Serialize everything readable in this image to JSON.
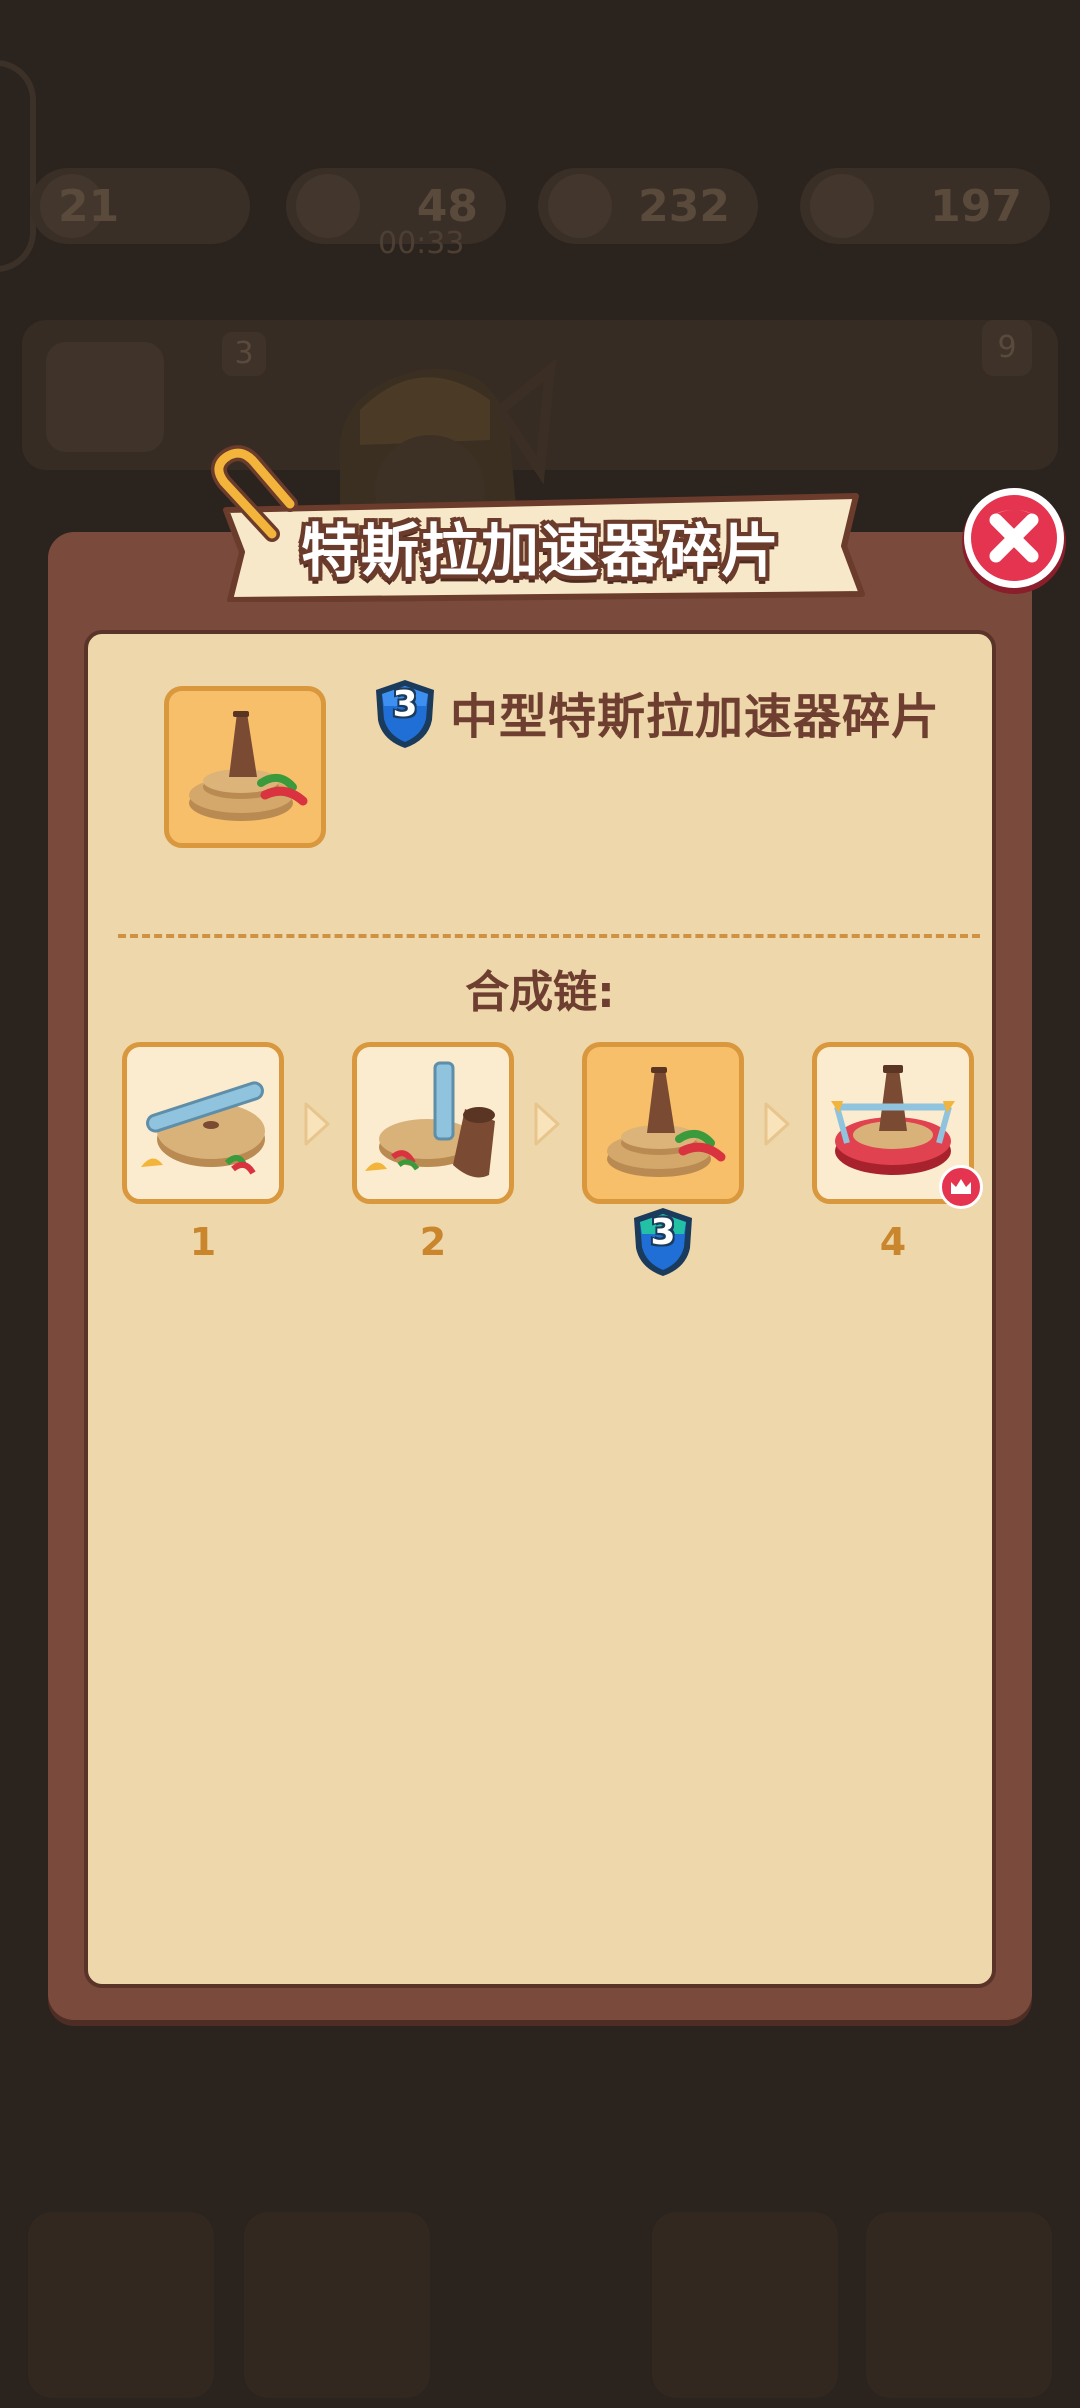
{
  "background": {
    "stats": [
      "21",
      "48",
      "00:33",
      "232",
      "197"
    ],
    "card_badge_left": "3",
    "card_badge_right": "9"
  },
  "modal": {
    "title": "特斯拉加速器碎片",
    "item": {
      "tier": "3",
      "name": "中型特斯拉加速器碎片"
    },
    "chain_label": "合成链:",
    "chain": [
      {
        "level": "1",
        "current": false
      },
      {
        "level": "2",
        "current": false
      },
      {
        "level": "3",
        "current": true
      },
      {
        "level": "4",
        "current": false,
        "max": true
      }
    ]
  },
  "colors": {
    "frame": "#7a4a3d",
    "panel": "#eed7ab",
    "slot_highlight": "#f7bf6a",
    "close_red": "#e4344f",
    "tier_blue": "#1f6fd6",
    "level_text": "#c9862c"
  },
  "icons": [
    "paperclip-icon",
    "close-icon",
    "tier-shield-icon",
    "chevron-right-icon",
    "crown-icon"
  ]
}
